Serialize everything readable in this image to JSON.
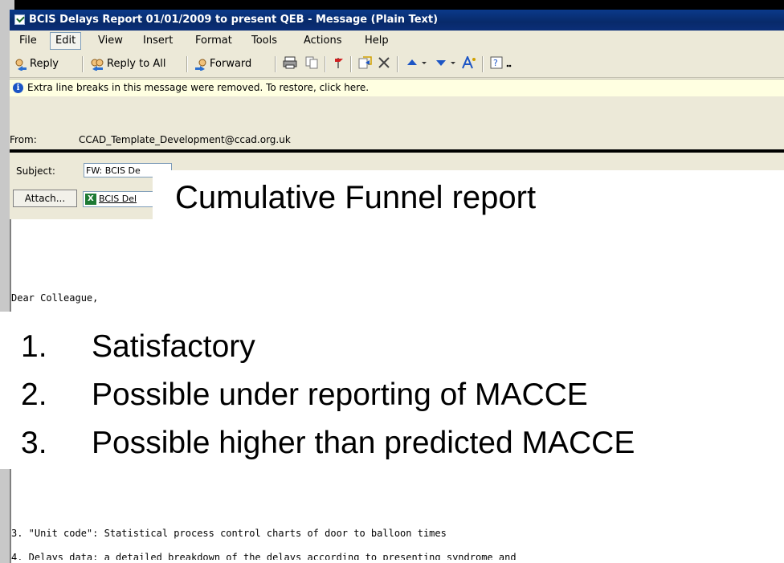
{
  "window": {
    "title": "BCIS Delays Report 01/01/2009 to present QEB - Message (Plain Text)"
  },
  "menu": {
    "items": [
      "File",
      "Edit",
      "View",
      "Insert",
      "Format",
      "Tools",
      "Actions",
      "Help"
    ],
    "active": "Edit"
  },
  "toolbar": {
    "reply_label": "Reply",
    "reply_all_label": "Reply to All",
    "forward_label": "Forward"
  },
  "info_bar": {
    "text": "Extra line breaks in this message were removed. To restore, click here."
  },
  "header": {
    "from_label": "From:",
    "from_value": "CCAD_Template_Development@ccad.org.uk",
    "subject_label": "Subject:",
    "subject_value": "FW: BCIS De",
    "attach_label": "Attach...",
    "attachment_name": "BCIS Del"
  },
  "body": {
    "greeting": "Dear Colleague,",
    "line_3": "3. \"Unit code\": Statistical process control charts of door to balloon times",
    "line_4": "4. Delays data: a detailed breakdown of the delays according to presenting syndrome and"
  },
  "overlay": {
    "title": "Cumulative Funnel report",
    "items": [
      {
        "num": "1.",
        "text": "Satisfactory"
      },
      {
        "num": "2.",
        "text": "Possible under reporting of MACCE"
      },
      {
        "num": "3.",
        "text": "Possible higher than predicted MACCE"
      }
    ]
  },
  "colors": {
    "title_bar": "#0a3a8a",
    "info_bar_bg": "#ffffe1",
    "window_bg": "#ece9d8"
  }
}
